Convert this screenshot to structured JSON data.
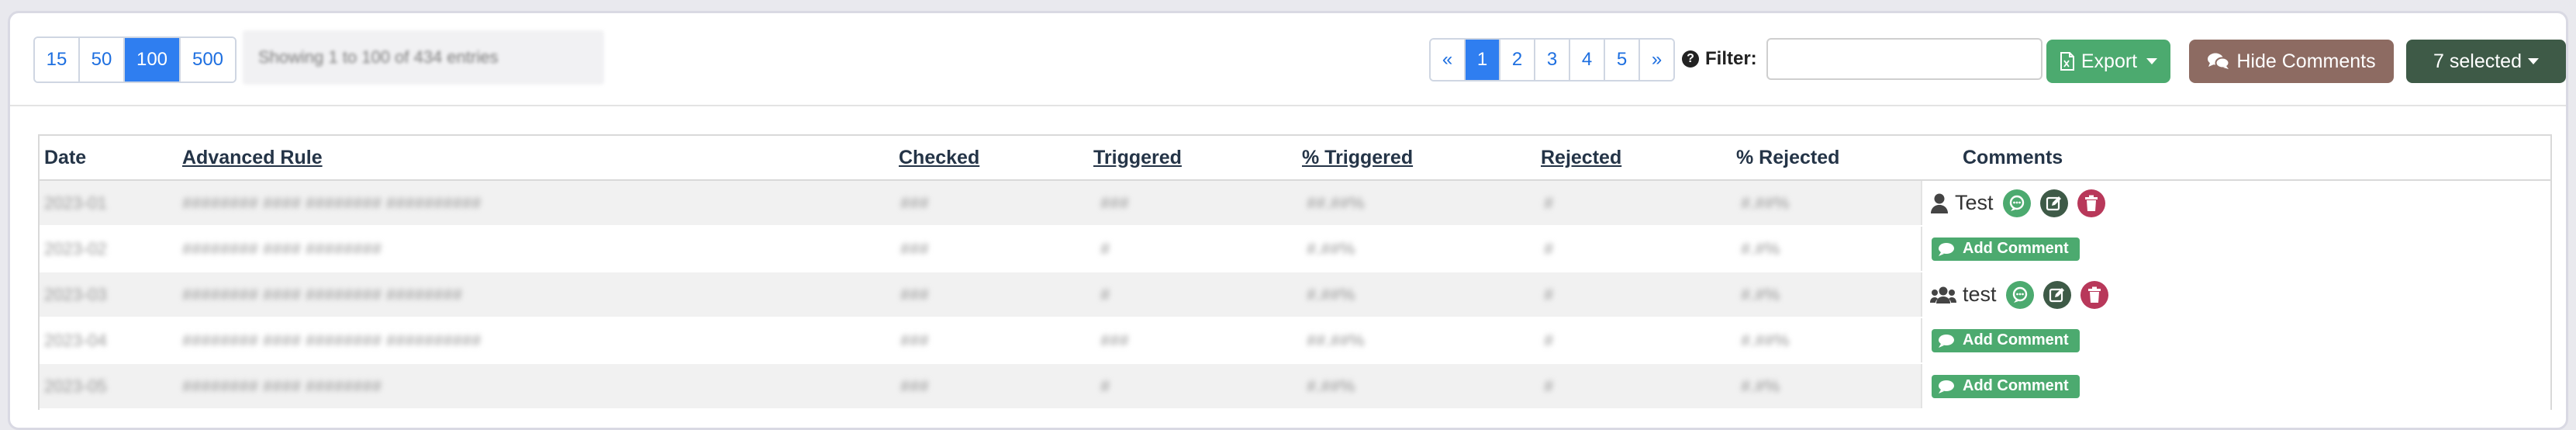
{
  "page_size": {
    "options": [
      "15",
      "50",
      "100",
      "500"
    ],
    "active": "100"
  },
  "info_text": "Showing 1 to 100 of 434 entries",
  "pagination": {
    "prev": "«",
    "pages": [
      "1",
      "2",
      "3",
      "4",
      "5"
    ],
    "active": "1",
    "next": "»"
  },
  "filter": {
    "label": "Filter:",
    "value": "",
    "placeholder": ""
  },
  "buttons": {
    "export": "Export",
    "hide_comments": "Hide Comments",
    "selected": "7 selected"
  },
  "colors": {
    "primary": "#2f7ef0",
    "success": "#4caa6f",
    "brown": "#8d6b62",
    "dark_green": "#3e5a47",
    "danger": "#b8385a"
  },
  "table": {
    "headers": {
      "date": "Date",
      "rule": "Advanced Rule",
      "checked": "Checked",
      "triggered": "Triggered",
      "pct_triggered": "% Triggered",
      "rejected": "Rejected",
      "pct_rejected": "% Rejected",
      "comments": "Comments"
    },
    "rows": [
      {
        "date": "2023-01",
        "rule": "######## #### ######## ##########",
        "checked": "###",
        "triggered": "###",
        "pct_triggered": "##.##%",
        "rejected": "#",
        "pct_rejected": "#.##%",
        "comment": {
          "type": "user",
          "icon": "user-icon",
          "text": "Test"
        }
      },
      {
        "date": "2023-02",
        "rule": "######## #### ########",
        "checked": "###",
        "triggered": "#",
        "pct_triggered": "#.##%",
        "rejected": "#",
        "pct_rejected": "#.#%",
        "comment": {
          "type": "add",
          "label": "Add Comment"
        }
      },
      {
        "date": "2023-03",
        "rule": "######## #### ######## ########",
        "checked": "###",
        "triggered": "#",
        "pct_triggered": "#.##%",
        "rejected": "#",
        "pct_rejected": "#.#%",
        "comment": {
          "type": "group",
          "icon": "users-icon",
          "text": "test"
        }
      },
      {
        "date": "2023-04",
        "rule": "######## #### ######## ##########",
        "checked": "###",
        "triggered": "###",
        "pct_triggered": "##.##%",
        "rejected": "#",
        "pct_rejected": "#.##%",
        "comment": {
          "type": "add",
          "label": "Add Comment"
        }
      },
      {
        "date": "2023-05",
        "rule": "######## #### ########",
        "checked": "###",
        "triggered": "#",
        "pct_triggered": "#.##%",
        "rejected": "#",
        "pct_rejected": "#.#%",
        "comment": {
          "type": "add",
          "label": "Add Comment"
        }
      }
    ]
  }
}
